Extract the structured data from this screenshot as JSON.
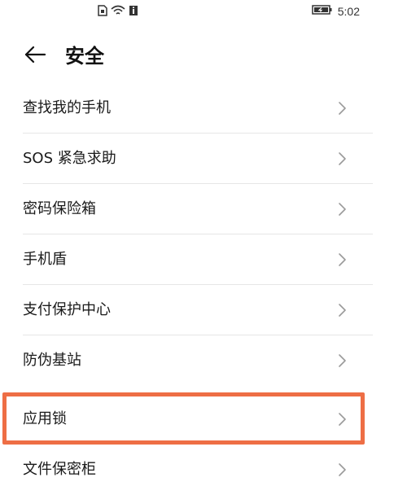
{
  "status_bar": {
    "time": "5:02",
    "icons": [
      "sim-card-icon",
      "wifi-icon",
      "info-icon",
      "battery-charging-icon"
    ]
  },
  "header": {
    "title": "安全"
  },
  "settings": {
    "items": [
      {
        "label": "查找我的手机"
      },
      {
        "label": "SOS 紧急求助"
      },
      {
        "label": "密码保险箱"
      },
      {
        "label": "手机盾"
      },
      {
        "label": "支付保护中心"
      },
      {
        "label": "防伪基站"
      },
      {
        "label": "应用锁",
        "highlighted": true
      },
      {
        "label": "文件保密柜"
      }
    ]
  },
  "colors": {
    "highlight": "#ee6e45",
    "divider": "#e6e6e6",
    "chevron": "#9a9a9a"
  }
}
